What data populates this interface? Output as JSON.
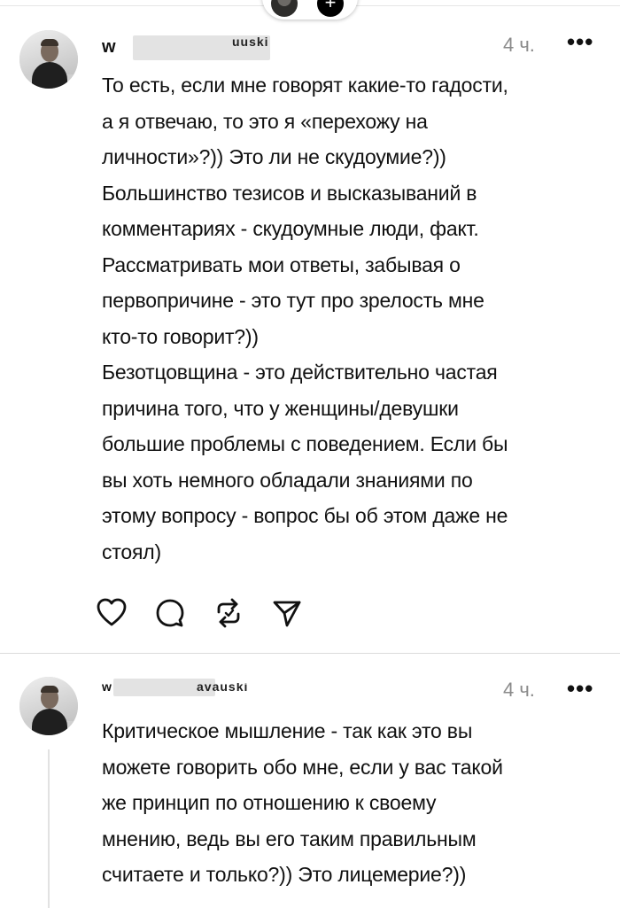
{
  "top_bar": {
    "avatar": "profile-avatar",
    "add_icon": "plus-icon"
  },
  "comments": [
    {
      "username": "w",
      "username_tail": "uuski",
      "time": "4 ч.",
      "more": "•••",
      "text": "То есть, если мне говорят какие-то гадости,\nа я отвечаю, то это я «перехожу на\nличности»?)) Это ли не скудоумие?))\nБольшинство тезисов и высказываний в\nкомментариях - скудоумные люди, факт.\nРассматривать мои ответы, забывая о\nпервопричине - это тут про зрелость мне\nкто-то говорит?))\nБезотцовщина - это действительно частая\nпричина того, что у женщины/девушки\nбольшие проблемы с поведением. Если бы\nвы хоть немного обладали знаниями по\nэтому вопросу - вопрос бы об этом даже не\nстоял)",
      "actions": [
        "heart-icon",
        "comment-icon",
        "repost-icon",
        "share-icon"
      ]
    },
    {
      "username": "w",
      "username_tail": "avauski",
      "time": "4 ч.",
      "more": "•••",
      "text": "Критическое мышление - так как это вы\nможете говорить обо мне, если у вас такой\nже принцип по отношению к своему\nмнению, ведь вы его таким правильным\nсчитаете и только?)) Это лицемерие?))"
    }
  ]
}
